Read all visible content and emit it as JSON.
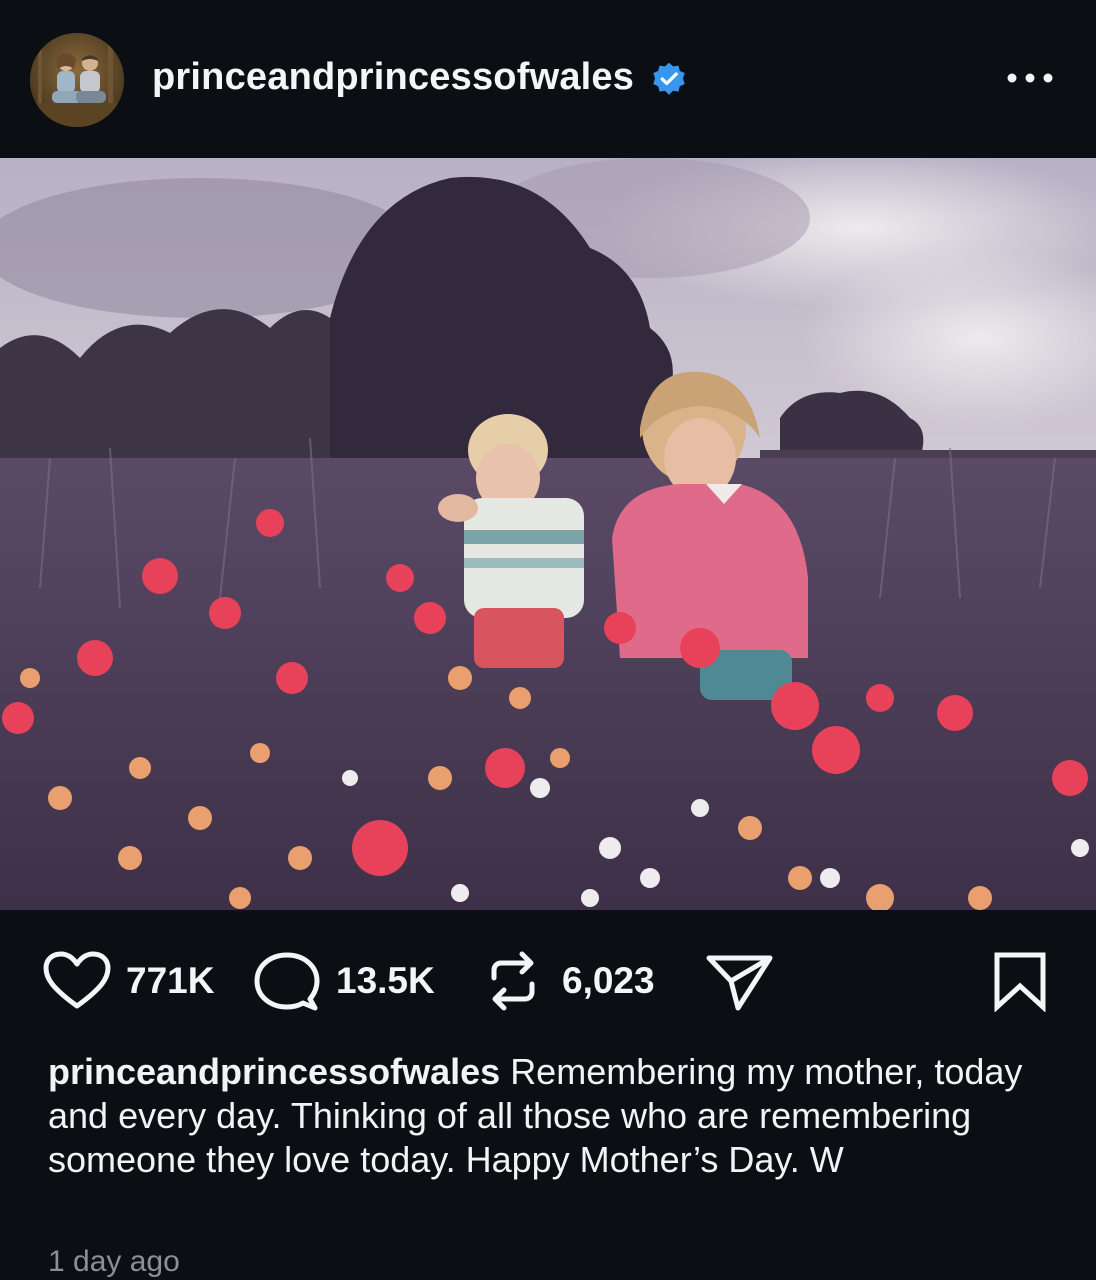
{
  "post": {
    "username": "princeandprincessofwales",
    "verified": true,
    "avatar_icon": "profile-photo-couple",
    "more_icon": "more-dots-icon",
    "photo_description_icon": "photo-image",
    "likes": "771K",
    "comments": "13.5K",
    "reposts": "6,023",
    "caption_user": "princeandprincessofwales",
    "caption_text": "Remembering my mother, today and every day. Thinking of all those who are remembering someone they love today. Happy Mother’s Day. W",
    "timestamp": "1 day ago"
  },
  "colors": {
    "background": "#0b0f13",
    "text": "#f4f5f7",
    "muted": "#8b9096",
    "verified_badge": "#3797f0"
  }
}
